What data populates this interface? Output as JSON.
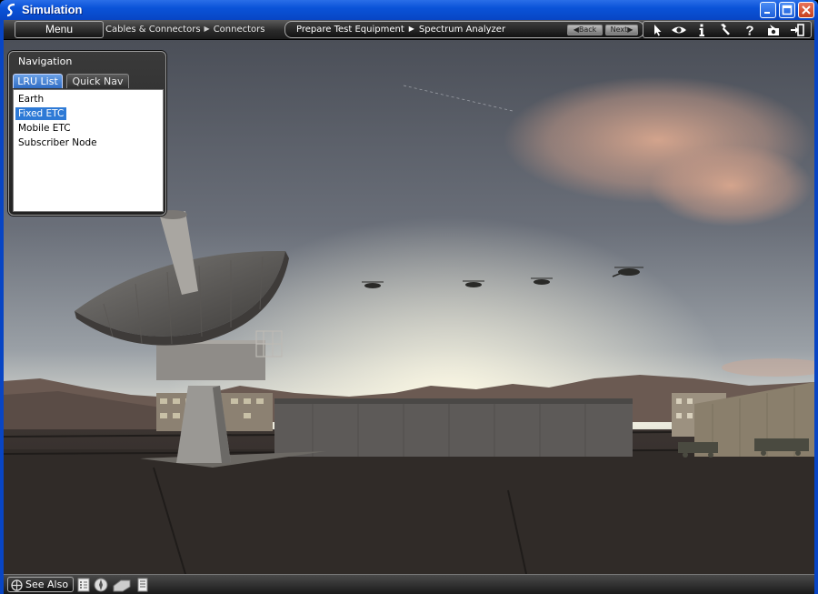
{
  "window": {
    "title": "Simulation",
    "controls": [
      "minimize-icon",
      "maximize-icon",
      "close-icon"
    ]
  },
  "toolbar": {
    "menu_label": "Menu",
    "breadcrumb_left": [
      "Cables & Connectors",
      "Connectors"
    ],
    "breadcrumb_main": [
      "Prepare Test Equipment",
      "Spectrum Analyzer"
    ],
    "back_label": "Back",
    "next_label": "Next",
    "tool_icons": [
      "pointer-icon",
      "eye-icon",
      "info-icon",
      "wrench-icon",
      "help-icon",
      "camera-icon",
      "exit-icon"
    ]
  },
  "navigation": {
    "title": "Navigation",
    "tabs": [
      {
        "label": "LRU List",
        "active": true
      },
      {
        "label": "Quick Nav",
        "active": false
      }
    ],
    "items": [
      {
        "label": "Earth",
        "selected": false
      },
      {
        "label": "Fixed ETC",
        "selected": true
      },
      {
        "label": "Mobile ETC",
        "selected": false
      },
      {
        "label": "Subscriber Node",
        "selected": false
      }
    ]
  },
  "bottombar": {
    "see_also_label": "See Also",
    "icons": [
      "checklist-icon",
      "compass-icon",
      "tag-icon",
      "document-icon"
    ]
  },
  "colors": {
    "titlebar": "#0a53d8",
    "selection": "#2e7ad6",
    "toolbar": "#2a2a2a"
  }
}
